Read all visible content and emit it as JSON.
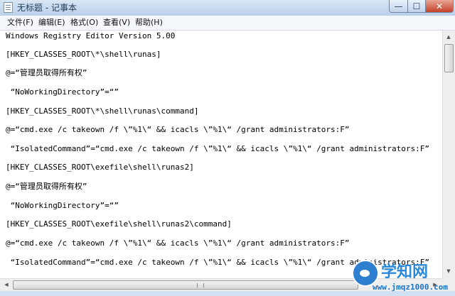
{
  "window": {
    "title": "无标题 - 记事本",
    "buttons": {
      "minimize": "—",
      "maximize": "☐",
      "close": "✕"
    }
  },
  "menubar": {
    "items": [
      {
        "label": "文件(F)"
      },
      {
        "label": "编辑(E)"
      },
      {
        "label": "格式(O)"
      },
      {
        "label": "查看(V)"
      },
      {
        "label": "帮助(H)"
      }
    ]
  },
  "editor": {
    "lines": [
      "Windows Registry Editor Version 5.00",
      "[HKEY_CLASSES_ROOT\\*\\shell\\runas]",
      "@=“管理员取得所有权”",
      " “NoWorkingDirectory”=“”",
      "[HKEY_CLASSES_ROOT\\*\\shell\\runas\\command]",
      "@=“cmd.exe /c takeown /f \\”%1\\“ && icacls \\”%1\\“ /grant administrators:F”",
      " “IsolatedCommand”=“cmd.exe /c takeown /f \\”%1\\“ && icacls \\”%1\\“ /grant administrators:F”",
      "[HKEY_CLASSES_ROOT\\exefile\\shell\\runas2]",
      "@=“管理员取得所有权”",
      " “NoWorkingDirectory”=“”",
      "[HKEY_CLASSES_ROOT\\exefile\\shell\\runas2\\command]",
      "@=“cmd.exe /c takeown /f \\”%1\\“ && icacls \\”%1\\“ /grant administrators:F”",
      " “IsolatedCommand”=“cmd.exe /c takeown /f \\”%1\\“ && icacls \\”%1\\“ /grant administrators:F”"
    ]
  },
  "scrollbars": {
    "up": "▲",
    "down": "▼",
    "left": "◀",
    "right": "▶"
  },
  "watermark": {
    "title": "学知网",
    "url": "www.jmqz1000.com"
  },
  "colors": {
    "titlebar": "#c6d8ee",
    "close_button": "#c4412a",
    "watermark_blue": "#2b89d9"
  }
}
